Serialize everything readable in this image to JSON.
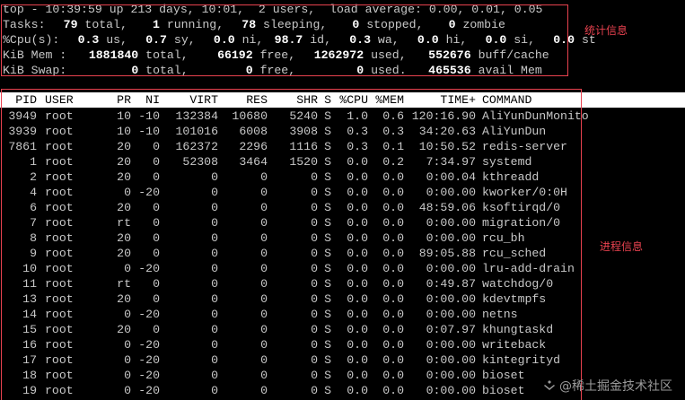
{
  "summary": {
    "line1": "top - 10:39:59 up 213 days, 10:01,  2 users,  load average: 0.00, 0.01, 0.05",
    "tasks": {
      "label": "Tasks:",
      "total": "79",
      "total_label": "total,",
      "running": "1",
      "running_label": "running,",
      "sleeping": "78",
      "sleeping_label": "sleeping,",
      "stopped": "0",
      "stopped_label": "stopped,",
      "zombie": "0",
      "zombie_label": "zombie"
    },
    "cpu": {
      "label": "%Cpu(s):",
      "us": "0.3",
      "us_label": "us,",
      "sy": "0.7",
      "sy_label": "sy,",
      "ni": "0.0",
      "ni_label": "ni,",
      "id": "98.7",
      "id_label": "id,",
      "wa": "0.3",
      "wa_label": "wa,",
      "hi": "0.0",
      "hi_label": "hi,",
      "si": "0.0",
      "si_label": "si,",
      "st": "0.0",
      "st_label": "st"
    },
    "mem": {
      "label": "KiB Mem :",
      "total": "1881840",
      "total_label": "total,",
      "free": "66192",
      "free_label": "free,",
      "used": "1262972",
      "used_label": "used,",
      "buff": "552676",
      "buff_label": "buff/cache"
    },
    "swap": {
      "label": "KiB Swap:",
      "total": "0",
      "total_label": "total,",
      "free": "0",
      "free_label": "free,",
      "used": "0",
      "used_label": "used.",
      "avail": "465536",
      "avail_label": "avail Mem"
    }
  },
  "annotations": {
    "stats_label": "统计信息",
    "process_label": "进程信息"
  },
  "columns": [
    "PID",
    "USER",
    "PR",
    "NI",
    "VIRT",
    "RES",
    "SHR",
    "S",
    "%CPU",
    "%MEM",
    "TIME+",
    "COMMAND"
  ],
  "processes": [
    {
      "pid": "3949",
      "user": "root",
      "pr": "10",
      "ni": "-10",
      "virt": "132384",
      "res": "10680",
      "shr": "5240",
      "s": "S",
      "cpu": "1.0",
      "mem": "0.6",
      "time": "120:16.90",
      "cmd": "AliYunDunMonito"
    },
    {
      "pid": "3939",
      "user": "root",
      "pr": "10",
      "ni": "-10",
      "virt": "101016",
      "res": "6008",
      "shr": "3908",
      "s": "S",
      "cpu": "0.3",
      "mem": "0.3",
      "time": "34:20.63",
      "cmd": "AliYunDun"
    },
    {
      "pid": "7861",
      "user": "root",
      "pr": "20",
      "ni": "0",
      "virt": "162372",
      "res": "2296",
      "shr": "1116",
      "s": "S",
      "cpu": "0.3",
      "mem": "0.1",
      "time": "10:50.52",
      "cmd": "redis-server"
    },
    {
      "pid": "1",
      "user": "root",
      "pr": "20",
      "ni": "0",
      "virt": "52308",
      "res": "3464",
      "shr": "1520",
      "s": "S",
      "cpu": "0.0",
      "mem": "0.2",
      "time": "7:34.97",
      "cmd": "systemd"
    },
    {
      "pid": "2",
      "user": "root",
      "pr": "20",
      "ni": "0",
      "virt": "0",
      "res": "0",
      "shr": "0",
      "s": "S",
      "cpu": "0.0",
      "mem": "0.0",
      "time": "0:00.04",
      "cmd": "kthreadd"
    },
    {
      "pid": "4",
      "user": "root",
      "pr": "0",
      "ni": "-20",
      "virt": "0",
      "res": "0",
      "shr": "0",
      "s": "S",
      "cpu": "0.0",
      "mem": "0.0",
      "time": "0:00.00",
      "cmd": "kworker/0:0H"
    },
    {
      "pid": "6",
      "user": "root",
      "pr": "20",
      "ni": "0",
      "virt": "0",
      "res": "0",
      "shr": "0",
      "s": "S",
      "cpu": "0.0",
      "mem": "0.0",
      "time": "48:59.06",
      "cmd": "ksoftirqd/0"
    },
    {
      "pid": "7",
      "user": "root",
      "pr": "rt",
      "ni": "0",
      "virt": "0",
      "res": "0",
      "shr": "0",
      "s": "S",
      "cpu": "0.0",
      "mem": "0.0",
      "time": "0:00.00",
      "cmd": "migration/0"
    },
    {
      "pid": "8",
      "user": "root",
      "pr": "20",
      "ni": "0",
      "virt": "0",
      "res": "0",
      "shr": "0",
      "s": "S",
      "cpu": "0.0",
      "mem": "0.0",
      "time": "0:00.00",
      "cmd": "rcu_bh"
    },
    {
      "pid": "9",
      "user": "root",
      "pr": "20",
      "ni": "0",
      "virt": "0",
      "res": "0",
      "shr": "0",
      "s": "S",
      "cpu": "0.0",
      "mem": "0.0",
      "time": "89:05.88",
      "cmd": "rcu_sched"
    },
    {
      "pid": "10",
      "user": "root",
      "pr": "0",
      "ni": "-20",
      "virt": "0",
      "res": "0",
      "shr": "0",
      "s": "S",
      "cpu": "0.0",
      "mem": "0.0",
      "time": "0:00.00",
      "cmd": "lru-add-drain"
    },
    {
      "pid": "11",
      "user": "root",
      "pr": "rt",
      "ni": "0",
      "virt": "0",
      "res": "0",
      "shr": "0",
      "s": "S",
      "cpu": "0.0",
      "mem": "0.0",
      "time": "0:49.87",
      "cmd": "watchdog/0"
    },
    {
      "pid": "13",
      "user": "root",
      "pr": "20",
      "ni": "0",
      "virt": "0",
      "res": "0",
      "shr": "0",
      "s": "S",
      "cpu": "0.0",
      "mem": "0.0",
      "time": "0:00.00",
      "cmd": "kdevtmpfs"
    },
    {
      "pid": "14",
      "user": "root",
      "pr": "0",
      "ni": "-20",
      "virt": "0",
      "res": "0",
      "shr": "0",
      "s": "S",
      "cpu": "0.0",
      "mem": "0.0",
      "time": "0:00.00",
      "cmd": "netns"
    },
    {
      "pid": "15",
      "user": "root",
      "pr": "20",
      "ni": "0",
      "virt": "0",
      "res": "0",
      "shr": "0",
      "s": "S",
      "cpu": "0.0",
      "mem": "0.0",
      "time": "0:07.97",
      "cmd": "khungtaskd"
    },
    {
      "pid": "16",
      "user": "root",
      "pr": "0",
      "ni": "-20",
      "virt": "0",
      "res": "0",
      "shr": "0",
      "s": "S",
      "cpu": "0.0",
      "mem": "0.0",
      "time": "0:00.00",
      "cmd": "writeback"
    },
    {
      "pid": "17",
      "user": "root",
      "pr": "0",
      "ni": "-20",
      "virt": "0",
      "res": "0",
      "shr": "0",
      "s": "S",
      "cpu": "0.0",
      "mem": "0.0",
      "time": "0:00.00",
      "cmd": "kintegrityd"
    },
    {
      "pid": "18",
      "user": "root",
      "pr": "0",
      "ni": "-20",
      "virt": "0",
      "res": "0",
      "shr": "0",
      "s": "S",
      "cpu": "0.0",
      "mem": "0.0",
      "time": "0:00.00",
      "cmd": "bioset"
    },
    {
      "pid": "19",
      "user": "root",
      "pr": "0",
      "ni": "-20",
      "virt": "0",
      "res": "0",
      "shr": "0",
      "s": "S",
      "cpu": "0.0",
      "mem": "0.0",
      "time": "0:00.00",
      "cmd": "bioset"
    }
  ],
  "watermark": "@稀土掘金技术社区",
  "colors": {
    "background": "#000000",
    "text": "#c8c8c8",
    "bold_text": "#ffffff",
    "header_bg": "#ffffff",
    "annotation": "#e8424f"
  }
}
